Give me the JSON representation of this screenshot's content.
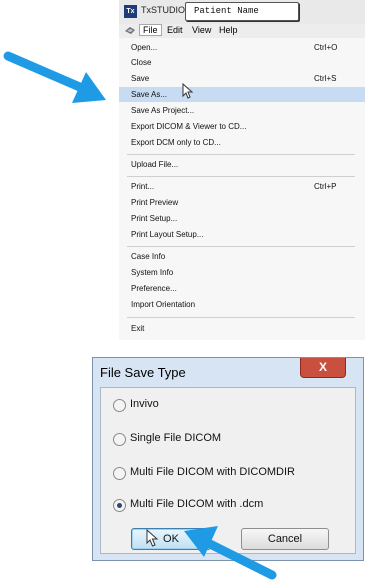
{
  "app": {
    "icon_text": "Tx",
    "title": "TxSTUDIO",
    "patient_name": "Patient Name"
  },
  "menubar": {
    "icon": "app-menu-icon",
    "items": [
      "File",
      "Edit",
      "View",
      "Help"
    ],
    "active": "File"
  },
  "file_menu": {
    "items": [
      {
        "label": "Open...",
        "shortcut": "Ctrl+O"
      },
      {
        "label": "Close",
        "shortcut": ""
      },
      {
        "label": "Save",
        "shortcut": "Ctrl+S"
      },
      {
        "label": "Save As...",
        "shortcut": "",
        "highlighted": true
      },
      {
        "label": "Save As Project...",
        "shortcut": ""
      },
      {
        "label": "Export DICOM & Viewer to CD...",
        "shortcut": ""
      },
      {
        "label": "Export DCM only to CD...",
        "shortcut": ""
      },
      {
        "label": "Upload File...",
        "shortcut": ""
      },
      {
        "label": "Print...",
        "shortcut": "Ctrl+P"
      },
      {
        "label": "Print Preview",
        "shortcut": ""
      },
      {
        "label": "Print Setup...",
        "shortcut": ""
      },
      {
        "label": "Print Layout Setup...",
        "shortcut": ""
      },
      {
        "label": "Case Info",
        "shortcut": ""
      },
      {
        "label": "System Info",
        "shortcut": ""
      },
      {
        "label": "Preference...",
        "shortcut": ""
      },
      {
        "label": "Import Orientation",
        "shortcut": ""
      },
      {
        "label": "Exit",
        "shortcut": ""
      }
    ]
  },
  "dialog": {
    "title": "File Save Type",
    "close_label": "X",
    "options": [
      {
        "label": "Invivo",
        "checked": false
      },
      {
        "label": "Single File DICOM",
        "checked": false
      },
      {
        "label": "Multi File DICOM with DICOMDIR",
        "checked": false
      },
      {
        "label": "Multi File DICOM with .dcm",
        "checked": true
      }
    ],
    "ok_label": "OK",
    "cancel_label": "Cancel"
  },
  "colors": {
    "highlight": "#c7dbf2",
    "arrow": "#1f9be6",
    "dialog_frame": "#d6e4f3",
    "close_button": "#c9503f"
  }
}
